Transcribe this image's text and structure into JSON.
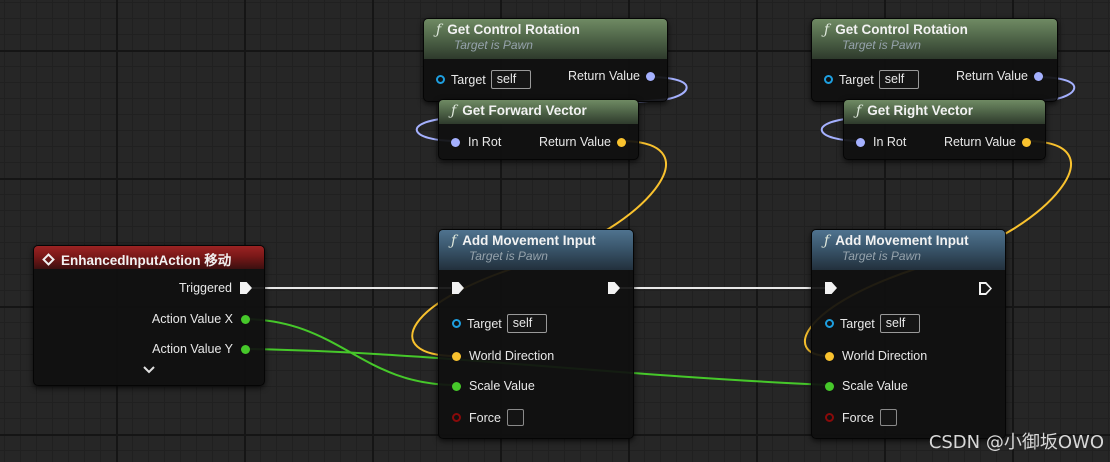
{
  "nodes": {
    "gcr1": {
      "title": "Get Control Rotation",
      "subtitle": "Target is Pawn",
      "target_label": "Target",
      "target_value": "self",
      "return_label": "Return Value"
    },
    "gfv": {
      "title": "Get Forward Vector",
      "in_label": "In Rot",
      "return_label": "Return Value"
    },
    "gcr2": {
      "title": "Get Control Rotation",
      "subtitle": "Target is Pawn",
      "target_label": "Target",
      "target_value": "self",
      "return_label": "Return Value"
    },
    "grv": {
      "title": "Get Right Vector",
      "in_label": "In Rot",
      "return_label": "Return Value"
    },
    "eia": {
      "title": "EnhancedInputAction 移动",
      "triggered": "Triggered",
      "action_x": "Action Value X",
      "action_y": "Action Value Y",
      "expand_icon": "chevron-down-icon"
    },
    "ami1": {
      "title": "Add Movement Input",
      "subtitle": "Target is Pawn",
      "target_label": "Target",
      "target_value": "self",
      "world_direction": "World Direction",
      "scale_value": "Scale Value",
      "force": "Force"
    },
    "ami2": {
      "title": "Add Movement Input",
      "subtitle": "Target is Pawn",
      "target_label": "Target",
      "target_value": "self",
      "world_direction": "World Direction",
      "scale_value": "Scale Value",
      "force": "Force"
    }
  },
  "pin_colors": {
    "exec": "#f2f2f2",
    "object": "#1e9fe0",
    "rotator": "#a5b1ff",
    "vector": "#f9c22e",
    "float": "#46c82a",
    "bool": "#8a0a0a"
  },
  "watermark": "CSDN @小御坂OWO"
}
